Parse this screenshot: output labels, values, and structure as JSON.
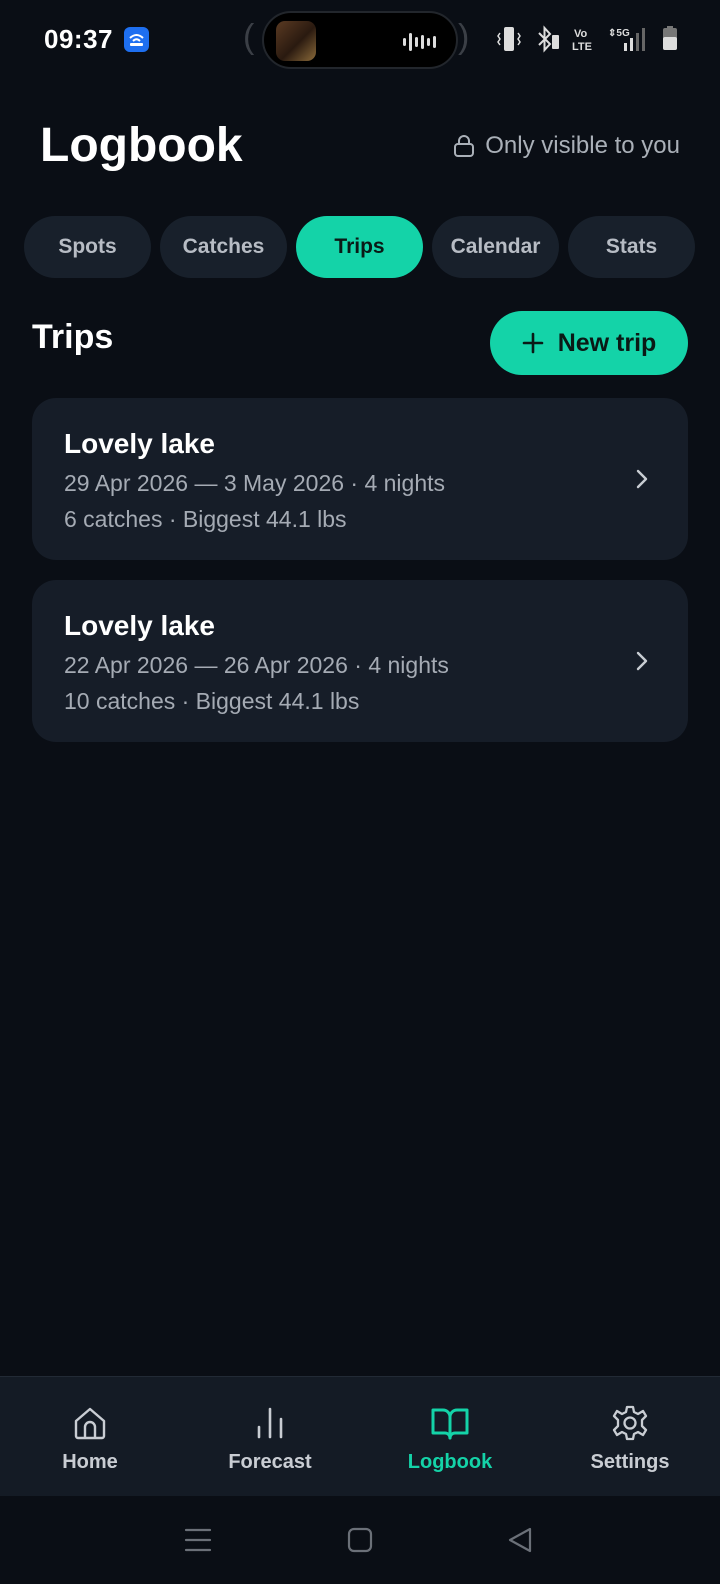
{
  "status_bar": {
    "time": "09:37"
  },
  "header": {
    "title": "Logbook",
    "privacy_label": "Only visible to you"
  },
  "tabs": [
    {
      "label": "Spots",
      "active": false
    },
    {
      "label": "Catches",
      "active": false
    },
    {
      "label": "Trips",
      "active": true
    },
    {
      "label": "Calendar",
      "active": false
    },
    {
      "label": "Stats",
      "active": false
    }
  ],
  "section": {
    "title": "Trips",
    "new_button_label": "New trip",
    "new_button_icon": "plus-icon"
  },
  "trips": [
    {
      "name": "Lovely lake",
      "dates": "29 Apr 2026 — 3 May 2026 · 4 nights",
      "summary": "6 catches · Biggest 44.1 lbs"
    },
    {
      "name": "Lovely lake",
      "dates": "22 Apr 2026 — 26 Apr 2026 · 4 nights",
      "summary": "10 catches · Biggest 44.1 lbs"
    }
  ],
  "bottom_nav": [
    {
      "label": "Home",
      "icon": "home-icon",
      "active": false
    },
    {
      "label": "Forecast",
      "icon": "bar-chart-icon",
      "active": false
    },
    {
      "label": "Logbook",
      "icon": "book-open-icon",
      "active": true
    },
    {
      "label": "Settings",
      "icon": "gear-icon",
      "active": false
    }
  ],
  "colors": {
    "accent": "#14d3a8",
    "background": "#0a0e15",
    "card": "#161d28"
  }
}
